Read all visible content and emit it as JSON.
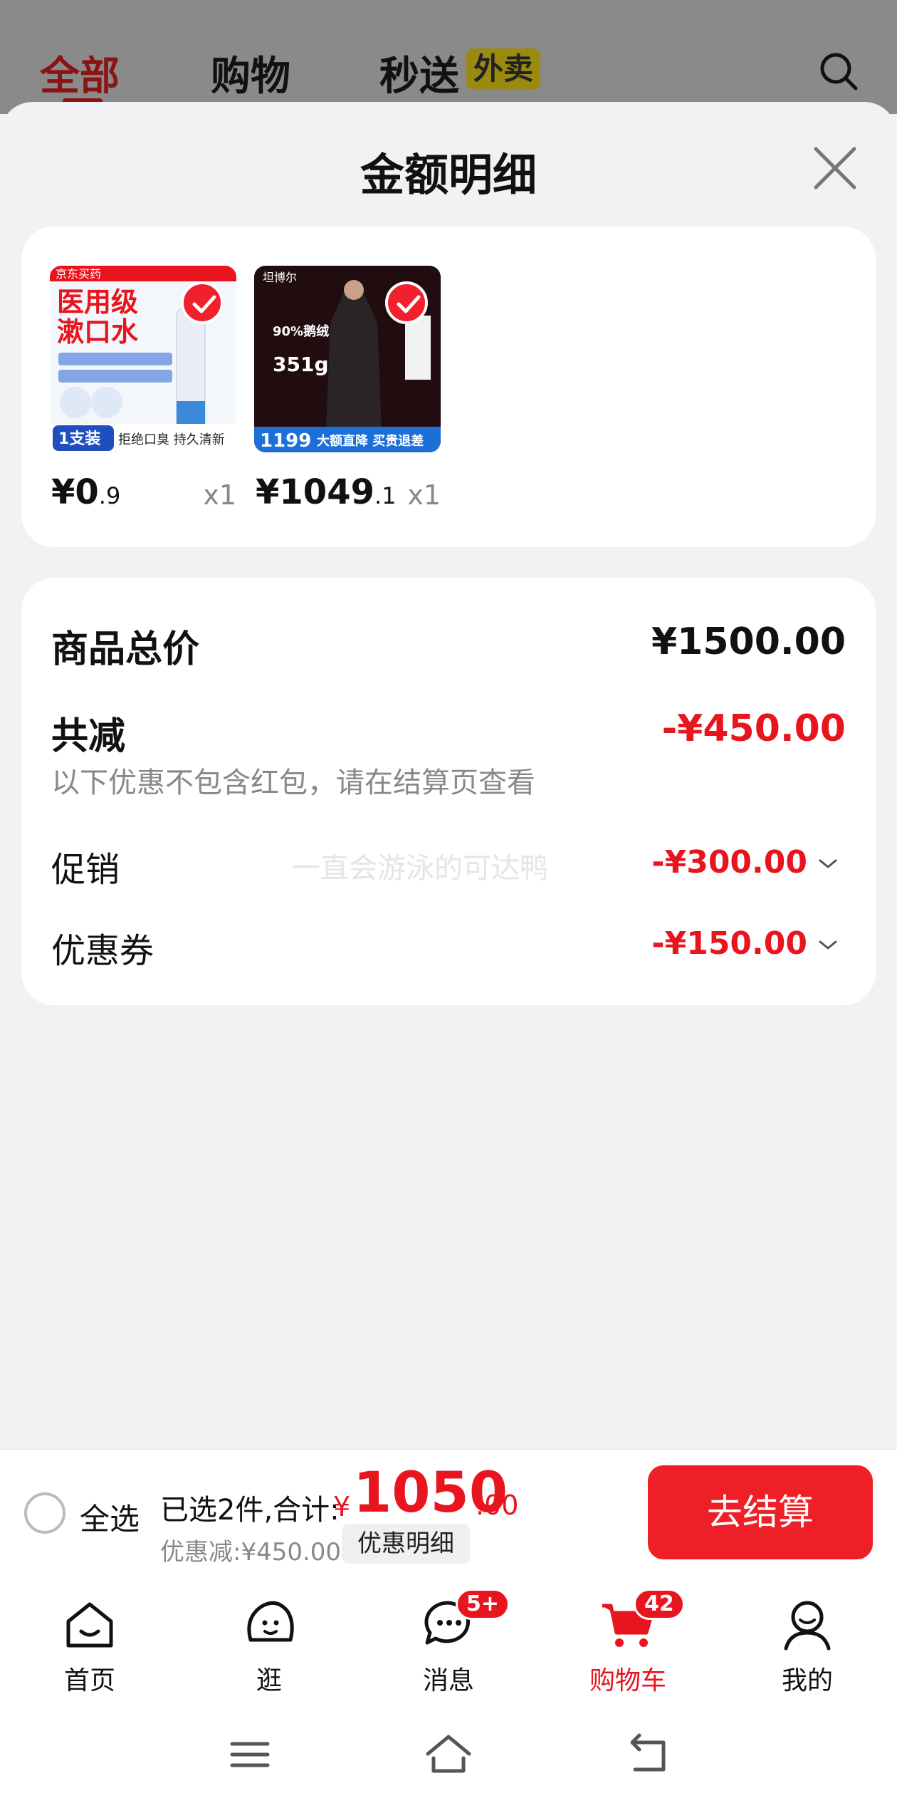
{
  "background_tabs": {
    "items": [
      {
        "label": "全部",
        "active": true
      },
      {
        "label": "购物",
        "active": false
      },
      {
        "label": "秒送",
        "active": false
      }
    ],
    "badge": "外卖",
    "search_icon": "search-icon"
  },
  "sheet": {
    "title": "金额明细",
    "close_icon": "close-icon"
  },
  "products": [
    {
      "price_main": "¥0",
      "price_decimal": ".9",
      "qty": "x1",
      "thumb_lines": [
        "京东买药",
        "医用级",
        "漱口水",
        "1支装",
        "拒绝口臭 持久清新"
      ]
    },
    {
      "price_main": "¥1049",
      "price_decimal": ".1",
      "qty": "x1",
      "thumb_lines": [
        "坦博尔",
        "90%鹅绒",
        "351g",
        "1199",
        "大额直降 买贵退差"
      ]
    }
  ],
  "summary": {
    "total_label": "商品总价",
    "total_value": "¥1500.00",
    "reduce_label": "共减",
    "reduce_value": "-¥450.00",
    "note": "以下优惠不包含红包，请在结算页查看",
    "promo_label": "促销",
    "promo_value": "-¥300.00",
    "coupon_label": "优惠券",
    "coupon_value": "-¥150.00",
    "watermark": "一直会游泳的可达鸭"
  },
  "checkout": {
    "select_all": "全选",
    "selected_text": "已选2件,合计:",
    "currency": "¥",
    "total_main": "1050",
    "total_cents": ".00",
    "discount_text": "优惠减:¥450.00",
    "discount_detail": "优惠明细",
    "button": "去结算"
  },
  "nav": {
    "items": [
      {
        "label": "首页",
        "icon": "home-icon"
      },
      {
        "label": "逛",
        "icon": "explore-icon"
      },
      {
        "label": "消息",
        "icon": "message-icon",
        "badge": "5+"
      },
      {
        "label": "购物车",
        "icon": "cart-icon",
        "badge": "42",
        "active": true
      },
      {
        "label": "我的",
        "icon": "profile-icon"
      }
    ]
  },
  "colors": {
    "accent": "#e8141e",
    "checkout_button": "#ee1f26"
  }
}
